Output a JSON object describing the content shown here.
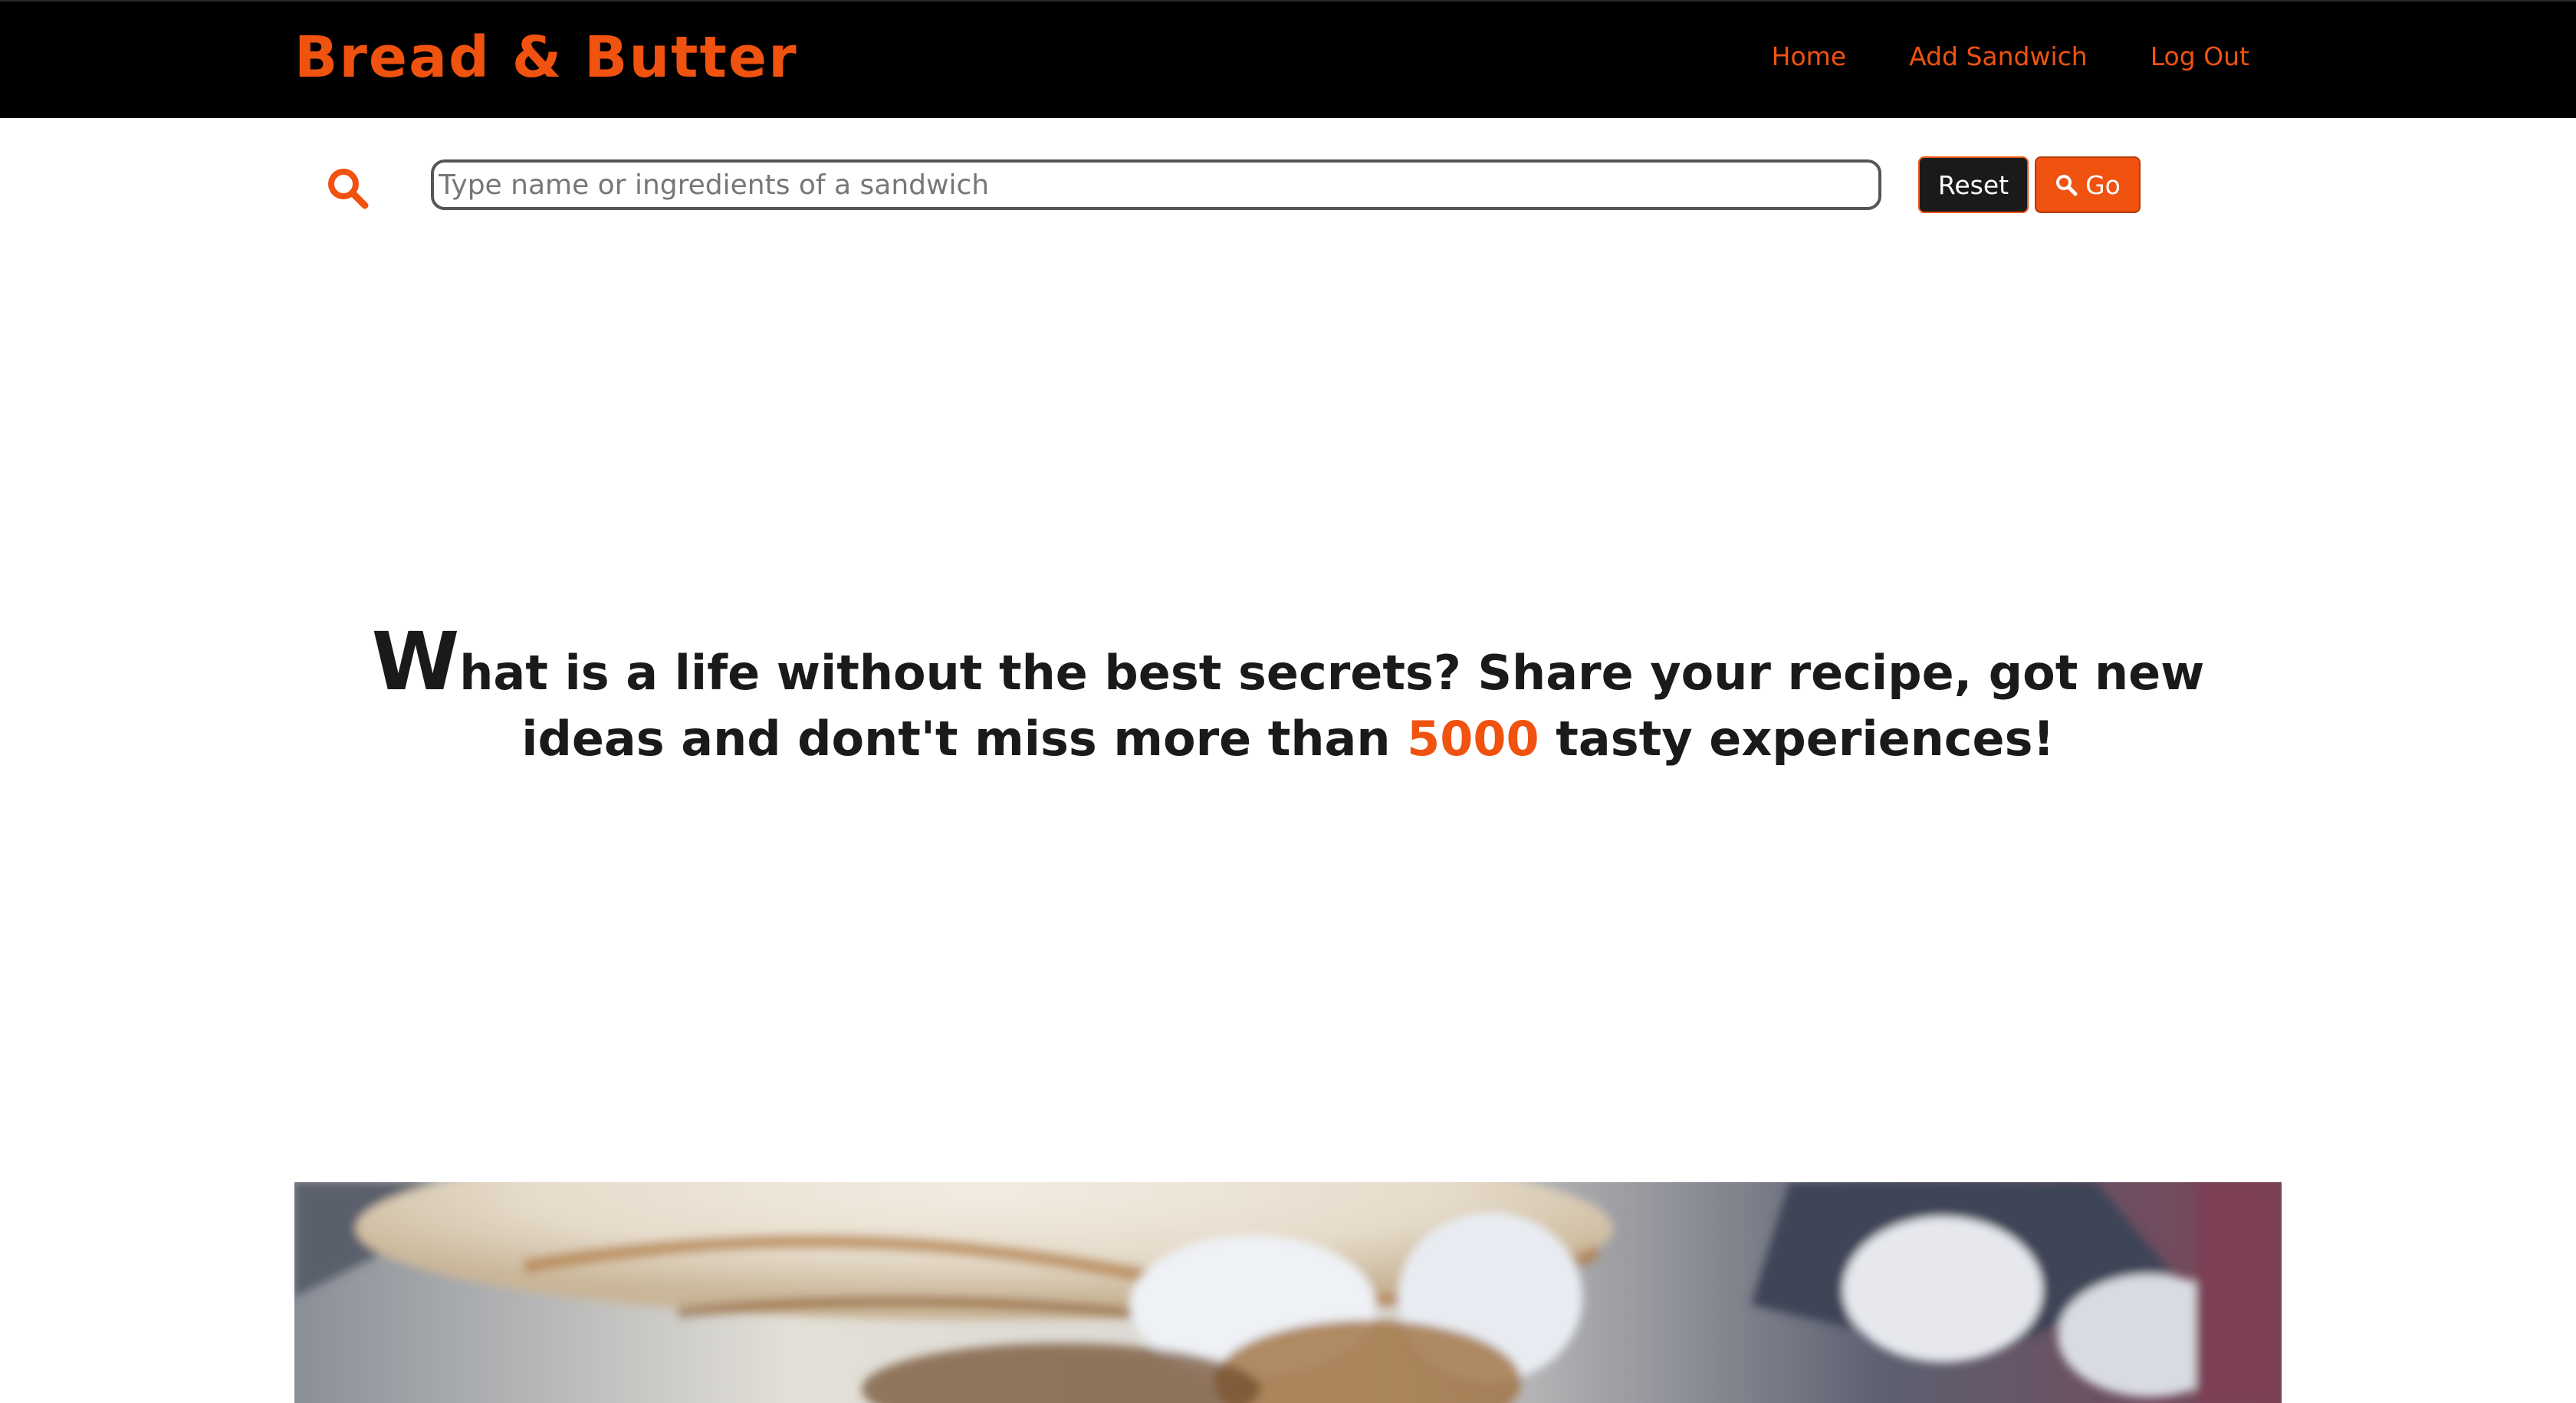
{
  "navbar": {
    "brand": "Bread & Butter",
    "links": [
      {
        "label": "Home"
      },
      {
        "label": "Add Sandwich"
      },
      {
        "label": "Log Out"
      }
    ]
  },
  "search": {
    "icon": "search-icon",
    "placeholder": "Type name or ingredients of a sandwich",
    "value": "",
    "reset_label": "Reset",
    "go_label": "Go",
    "go_icon": "search-icon"
  },
  "hero": {
    "dropcap": "W",
    "text_before": "hat is a life without the best secrets? Share your recipe, got new ideas and dont't miss more than ",
    "highlight": "5000",
    "text_after": " tasty experiences!"
  },
  "food_image": {
    "icon": "sandwich-photo"
  },
  "colors": {
    "accent": "#f0520f",
    "navbar_bg": "#000000",
    "text": "#1a1a1a",
    "reset_bg": "#1a1a1a"
  }
}
